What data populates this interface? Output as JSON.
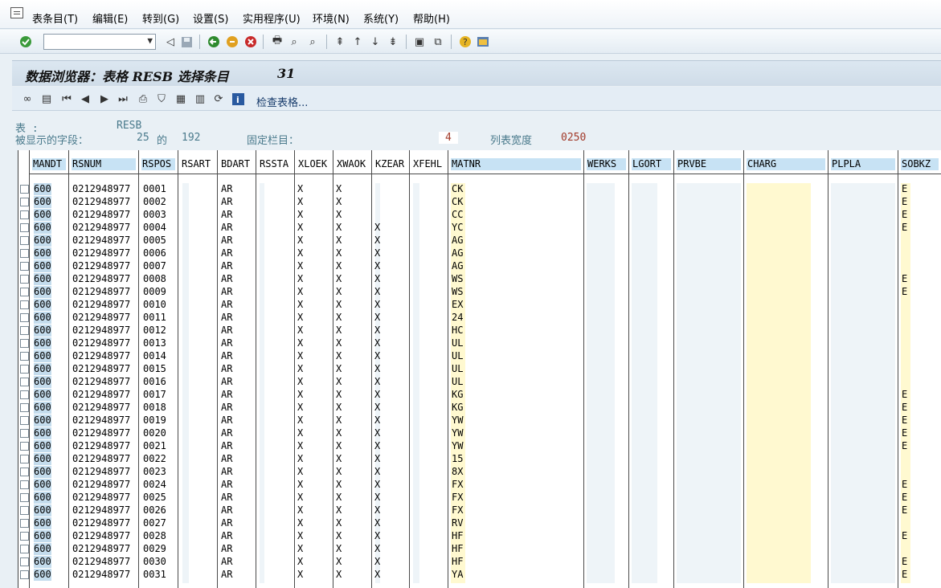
{
  "menu": {
    "items": [
      "表条目(T)",
      "编辑(E)",
      "转到(G)",
      "设置(S)",
      "实用程序(U)",
      "环境(N)",
      "系统(Y)",
      "帮助(H)"
    ]
  },
  "toolbar": {
    "command_value": ""
  },
  "title": {
    "text": "数据浏览器：表格 RESB 选择条目",
    "count": "31"
  },
  "apptoolbar": {
    "check_table_label": "检查表格..."
  },
  "info": {
    "table_label": "表      :",
    "table_value": "RESB",
    "fields_label": "被显示的字段：",
    "fields_shown": "25",
    "fields_of": "的",
    "fields_total": "192",
    "fixed_label": "固定栏目：",
    "fixed_value": "4",
    "width_label": "列表宽度",
    "width_value": "0250"
  },
  "grid": {
    "headers": [
      "MANDT",
      "RSNUM",
      "RSPOS",
      "RSART",
      "BDART",
      "RSSTA",
      "XLOEK",
      "XWAOK",
      "KZEAR",
      "XFEHL",
      "MATNR",
      "WERKS",
      "LGORT",
      "PRVBE",
      "CHARG",
      "PLPLA",
      "SOBKZ"
    ],
    "rows": [
      {
        "mandt": "600",
        "rsnum": "0212948977",
        "rspos": "0001",
        "bdart": "AR",
        "xloek": "X",
        "xwaok": "X",
        "kzear": "",
        "matnr": "CK",
        "sobkz": "E"
      },
      {
        "mandt": "600",
        "rsnum": "0212948977",
        "rspos": "0002",
        "bdart": "AR",
        "xloek": "X",
        "xwaok": "X",
        "kzear": "",
        "matnr": "CK",
        "sobkz": "E"
      },
      {
        "mandt": "600",
        "rsnum": "0212948977",
        "rspos": "0003",
        "bdart": "AR",
        "xloek": "X",
        "xwaok": "X",
        "kzear": "",
        "matnr": "CC",
        "sobkz": "E"
      },
      {
        "mandt": "600",
        "rsnum": "0212948977",
        "rspos": "0004",
        "bdart": "AR",
        "xloek": "X",
        "xwaok": "X",
        "kzear": "X",
        "matnr": "YC",
        "sobkz": "E"
      },
      {
        "mandt": "600",
        "rsnum": "0212948977",
        "rspos": "0005",
        "bdart": "AR",
        "xloek": "X",
        "xwaok": "X",
        "kzear": "X",
        "matnr": "AG",
        "sobkz": ""
      },
      {
        "mandt": "600",
        "rsnum": "0212948977",
        "rspos": "0006",
        "bdart": "AR",
        "xloek": "X",
        "xwaok": "X",
        "kzear": "X",
        "matnr": "AG",
        "sobkz": ""
      },
      {
        "mandt": "600",
        "rsnum": "0212948977",
        "rspos": "0007",
        "bdart": "AR",
        "xloek": "X",
        "xwaok": "X",
        "kzear": "X",
        "matnr": "AG",
        "sobkz": ""
      },
      {
        "mandt": "600",
        "rsnum": "0212948977",
        "rspos": "0008",
        "bdart": "AR",
        "xloek": "X",
        "xwaok": "X",
        "kzear": "X",
        "matnr": "WS",
        "sobkz": "E"
      },
      {
        "mandt": "600",
        "rsnum": "0212948977",
        "rspos": "0009",
        "bdart": "AR",
        "xloek": "X",
        "xwaok": "X",
        "kzear": "X",
        "matnr": "WS",
        "sobkz": "E"
      },
      {
        "mandt": "600",
        "rsnum": "0212948977",
        "rspos": "0010",
        "bdart": "AR",
        "xloek": "X",
        "xwaok": "X",
        "kzear": "X",
        "matnr": "EX",
        "sobkz": ""
      },
      {
        "mandt": "600",
        "rsnum": "0212948977",
        "rspos": "0011",
        "bdart": "AR",
        "xloek": "X",
        "xwaok": "X",
        "kzear": "X",
        "matnr": "24",
        "sobkz": ""
      },
      {
        "mandt": "600",
        "rsnum": "0212948977",
        "rspos": "0012",
        "bdart": "AR",
        "xloek": "X",
        "xwaok": "X",
        "kzear": "X",
        "matnr": "HC",
        "sobkz": ""
      },
      {
        "mandt": "600",
        "rsnum": "0212948977",
        "rspos": "0013",
        "bdart": "AR",
        "xloek": "X",
        "xwaok": "X",
        "kzear": "X",
        "matnr": "UL",
        "sobkz": ""
      },
      {
        "mandt": "600",
        "rsnum": "0212948977",
        "rspos": "0014",
        "bdart": "AR",
        "xloek": "X",
        "xwaok": "X",
        "kzear": "X",
        "matnr": "UL",
        "sobkz": ""
      },
      {
        "mandt": "600",
        "rsnum": "0212948977",
        "rspos": "0015",
        "bdart": "AR",
        "xloek": "X",
        "xwaok": "X",
        "kzear": "X",
        "matnr": "UL",
        "sobkz": ""
      },
      {
        "mandt": "600",
        "rsnum": "0212948977",
        "rspos": "0016",
        "bdart": "AR",
        "xloek": "X",
        "xwaok": "X",
        "kzear": "X",
        "matnr": "UL",
        "sobkz": ""
      },
      {
        "mandt": "600",
        "rsnum": "0212948977",
        "rspos": "0017",
        "bdart": "AR",
        "xloek": "X",
        "xwaok": "X",
        "kzear": "X",
        "matnr": "KG",
        "sobkz": "E"
      },
      {
        "mandt": "600",
        "rsnum": "0212948977",
        "rspos": "0018",
        "bdart": "AR",
        "xloek": "X",
        "xwaok": "X",
        "kzear": "X",
        "matnr": "KG",
        "sobkz": "E"
      },
      {
        "mandt": "600",
        "rsnum": "0212948977",
        "rspos": "0019",
        "bdart": "AR",
        "xloek": "X",
        "xwaok": "X",
        "kzear": "X",
        "matnr": "YW",
        "sobkz": "E"
      },
      {
        "mandt": "600",
        "rsnum": "0212948977",
        "rspos": "0020",
        "bdart": "AR",
        "xloek": "X",
        "xwaok": "X",
        "kzear": "X",
        "matnr": "YW",
        "sobkz": "E"
      },
      {
        "mandt": "600",
        "rsnum": "0212948977",
        "rspos": "0021",
        "bdart": "AR",
        "xloek": "X",
        "xwaok": "X",
        "kzear": "X",
        "matnr": "YW",
        "sobkz": "E"
      },
      {
        "mandt": "600",
        "rsnum": "0212948977",
        "rspos": "0022",
        "bdart": "AR",
        "xloek": "X",
        "xwaok": "X",
        "kzear": "X",
        "matnr": "15",
        "sobkz": ""
      },
      {
        "mandt": "600",
        "rsnum": "0212948977",
        "rspos": "0023",
        "bdart": "AR",
        "xloek": "X",
        "xwaok": "X",
        "kzear": "X",
        "matnr": "8X",
        "sobkz": ""
      },
      {
        "mandt": "600",
        "rsnum": "0212948977",
        "rspos": "0024",
        "bdart": "AR",
        "xloek": "X",
        "xwaok": "X",
        "kzear": "X",
        "matnr": "FX",
        "sobkz": "E"
      },
      {
        "mandt": "600",
        "rsnum": "0212948977",
        "rspos": "0025",
        "bdart": "AR",
        "xloek": "X",
        "xwaok": "X",
        "kzear": "X",
        "matnr": "FX",
        "sobkz": "E"
      },
      {
        "mandt": "600",
        "rsnum": "0212948977",
        "rspos": "0026",
        "bdart": "AR",
        "xloek": "X",
        "xwaok": "X",
        "kzear": "X",
        "matnr": "FX",
        "sobkz": "E"
      },
      {
        "mandt": "600",
        "rsnum": "0212948977",
        "rspos": "0027",
        "bdart": "AR",
        "xloek": "X",
        "xwaok": "X",
        "kzear": "X",
        "matnr": "RV",
        "sobkz": ""
      },
      {
        "mandt": "600",
        "rsnum": "0212948977",
        "rspos": "0028",
        "bdart": "AR",
        "xloek": "X",
        "xwaok": "X",
        "kzear": "X",
        "matnr": "HF",
        "sobkz": "E"
      },
      {
        "mandt": "600",
        "rsnum": "0212948977",
        "rspos": "0029",
        "bdart": "AR",
        "xloek": "X",
        "xwaok": "X",
        "kzear": "X",
        "matnr": "HF",
        "sobkz": ""
      },
      {
        "mandt": "600",
        "rsnum": "0212948977",
        "rspos": "0030",
        "bdart": "AR",
        "xloek": "X",
        "xwaok": "X",
        "kzear": "X",
        "matnr": "HF",
        "sobkz": "E"
      },
      {
        "mandt": "600",
        "rsnum": "0212948977",
        "rspos": "0031",
        "bdart": "AR",
        "xloek": "X",
        "xwaok": "X",
        "kzear": "X",
        "matnr": "YA",
        "sobkz": "E"
      }
    ]
  },
  "colors": {
    "key_column": "#c4dced",
    "matnr_fill": "#fff9d0",
    "charg_fill": "#fff9d0",
    "info_text": "#4a7a8c",
    "info_value_red": "#a23a2a"
  }
}
